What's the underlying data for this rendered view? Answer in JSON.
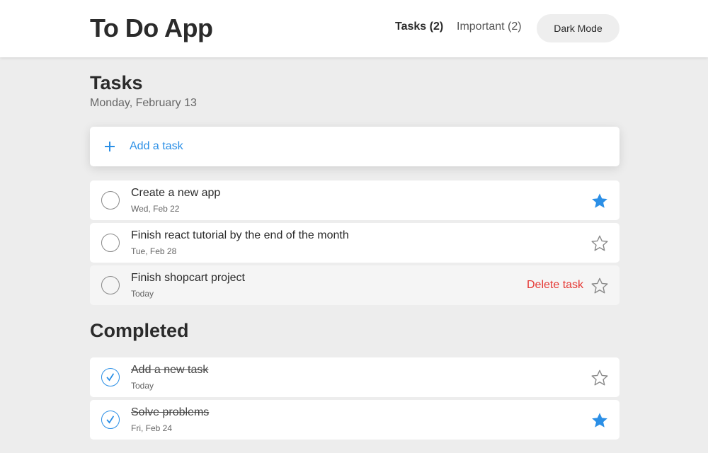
{
  "header": {
    "app_title": "To Do App",
    "nav_tasks": "Tasks (2)",
    "nav_important": "Important (2)",
    "dark_mode_label": "Dark Mode"
  },
  "main": {
    "section_title": "Tasks",
    "date": "Monday, February 13",
    "add_task": {
      "label": "Add a task",
      "icon": "plus-icon"
    },
    "tasks": [
      {
        "title": "Create a new app",
        "date": "Wed, Feb 22",
        "important": true,
        "completed": false
      },
      {
        "title": "Finish react tutorial by the end of the month",
        "date": "Tue, Feb 28",
        "important": false,
        "completed": false
      },
      {
        "title": "Finish shopcart project",
        "date": "Today",
        "important": false,
        "completed": false,
        "delete_label": "Delete task"
      }
    ]
  },
  "completed": {
    "section_title": "Completed",
    "tasks": [
      {
        "title": "Add a new task",
        "date": "Today",
        "important": false,
        "completed": true
      },
      {
        "title": "Solve problems",
        "date": "Fri, Feb 24",
        "important": true,
        "completed": true
      }
    ]
  },
  "colors": {
    "accent": "#2b8fe6",
    "delete": "#e53935",
    "background": "#ededed",
    "card": "#ffffff"
  }
}
